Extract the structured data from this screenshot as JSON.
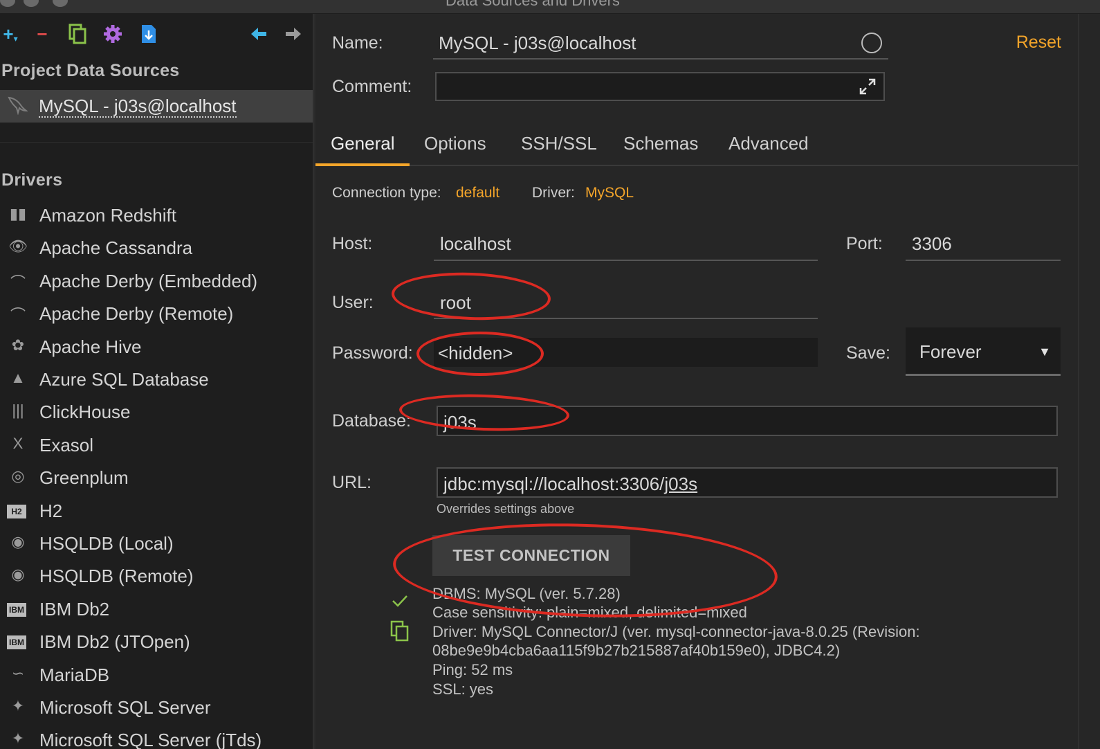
{
  "window": {
    "title": "Data Sources and Drivers"
  },
  "sidebar": {
    "toolbar": {
      "add": "+",
      "remove": "−",
      "copy_icon": "copy-icon",
      "settings_icon": "gear-icon",
      "import_icon": "import-icon",
      "back": "🡐",
      "forward": "🡒"
    },
    "project_title": "Project Data Sources",
    "data_sources": [
      {
        "label": "MySQL - j03s@localhost",
        "icon": "dolphin-icon"
      }
    ],
    "drivers_title": "Drivers",
    "drivers": [
      {
        "label": "Amazon Redshift",
        "glyph": "▮▮"
      },
      {
        "label": "Apache Cassandra",
        "glyph": "👁"
      },
      {
        "label": "Apache Derby (Embedded)",
        "glyph": "⌒"
      },
      {
        "label": "Apache Derby (Remote)",
        "glyph": "⌒"
      },
      {
        "label": "Apache Hive",
        "glyph": "✿"
      },
      {
        "label": "Azure SQL Database",
        "glyph": "▲"
      },
      {
        "label": "ClickHouse",
        "glyph": "|||"
      },
      {
        "label": "Exasol",
        "glyph": "X"
      },
      {
        "label": "Greenplum",
        "glyph": "◎"
      },
      {
        "label": "H2",
        "glyph": "H2"
      },
      {
        "label": "HSQLDB (Local)",
        "glyph": "◉"
      },
      {
        "label": "HSQLDB (Remote)",
        "glyph": "◉"
      },
      {
        "label": "IBM Db2",
        "glyph": "IBM"
      },
      {
        "label": "IBM Db2 (JTOpen)",
        "glyph": "IBM"
      },
      {
        "label": "MariaDB",
        "glyph": "∽"
      },
      {
        "label": "Microsoft SQL Server",
        "glyph": "✦"
      },
      {
        "label": "Microsoft SQL Server (jTds)",
        "glyph": "✦"
      }
    ]
  },
  "form": {
    "name_label": "Name:",
    "name_value": "MySQL - j03s@localhost",
    "reset": "Reset",
    "comment_label": "Comment:",
    "tabs": [
      "General",
      "Options",
      "SSH/SSL",
      "Schemas",
      "Advanced"
    ],
    "connection_type_label": "Connection type:",
    "connection_type_value": "default",
    "driver_label": "Driver:",
    "driver_value": "MySQL",
    "host_label": "Host:",
    "host_value": "localhost",
    "port_label": "Port:",
    "port_value": "3306",
    "user_label": "User:",
    "user_value": "root",
    "password_label": "Password:",
    "password_value": "<hidden>",
    "save_label": "Save:",
    "save_value": "Forever",
    "database_label": "Database:",
    "database_value": "j03s",
    "url_label": "URL:",
    "url_prefix": "jdbc:mysql://localhost:3306/",
    "url_db": "j03s",
    "url_hint": "Overrides settings above",
    "test_button": "TEST CONNECTION",
    "result_lines": [
      "DBMS: MySQL (ver. 5.7.28)",
      "Case sensitivity: plain=mixed, delimited=mixed",
      "Driver: MySQL Connector/J (ver. mysql-connector-java-8.0.25 (Revision:",
      "08be9e9b4cba6aa115f9b27b215887af40b159e0), JDBC4.2)",
      "Ping: 52 ms",
      "SSL: yes"
    ]
  },
  "colors": {
    "accent": "#f4a52a",
    "annotation": "#dc2a22",
    "success": "#8bc34a"
  }
}
